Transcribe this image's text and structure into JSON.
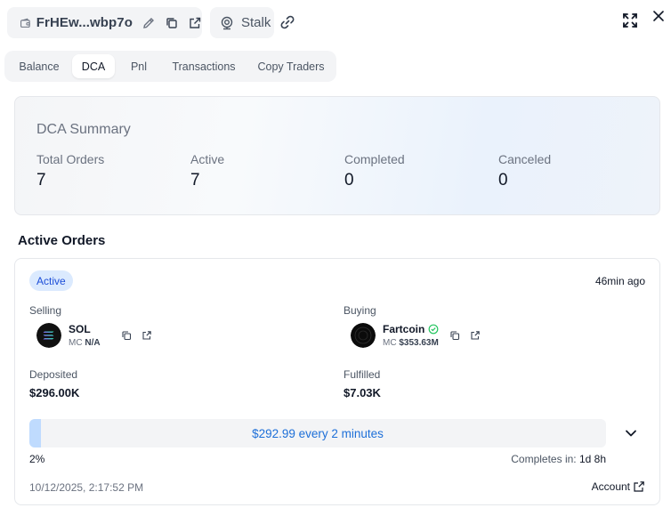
{
  "header": {
    "wallet_address": "FrHEw...wbp7o",
    "stalk_label": "Stalk"
  },
  "tabs": [
    {
      "label": "Balance",
      "active": false
    },
    {
      "label": "DCA",
      "active": true
    },
    {
      "label": "Pnl",
      "active": false
    },
    {
      "label": "Transactions",
      "active": false
    },
    {
      "label": "Copy Traders",
      "active": false
    }
  ],
  "summary": {
    "title": "DCA Summary",
    "stats": [
      {
        "label": "Total Orders",
        "value": "7"
      },
      {
        "label": "Active",
        "value": "7"
      },
      {
        "label": "Completed",
        "value": "0"
      },
      {
        "label": "Canceled",
        "value": "0"
      }
    ]
  },
  "active_orders": {
    "title": "Active Orders",
    "order": {
      "status": "Active",
      "time_ago": "46min ago",
      "selling": {
        "label": "Selling",
        "symbol": "SOL",
        "mc_label": "MC",
        "mc_value": "N/A"
      },
      "buying": {
        "label": "Buying",
        "symbol": "Fartcoin",
        "mc_label": "MC",
        "mc_value": "$353.63M"
      },
      "deposited_label": "Deposited",
      "deposited_value": "$296.00K",
      "fulfilled_label": "Fulfilled",
      "fulfilled_value": "$7.03K",
      "progress_percent": 2,
      "progress_label": "2%",
      "schedule_text": "$292.99 every 2 minutes",
      "completes_label": "Completes in:",
      "completes_value": "1d 8h",
      "date": "10/12/2025, 2:17:52 PM",
      "account_label": "Account"
    }
  },
  "colors": {
    "accent": "#1d6fd8",
    "badge_bg": "#dbeafe",
    "progress_fill": "#bfdbfe",
    "verified": "#22c55e"
  }
}
